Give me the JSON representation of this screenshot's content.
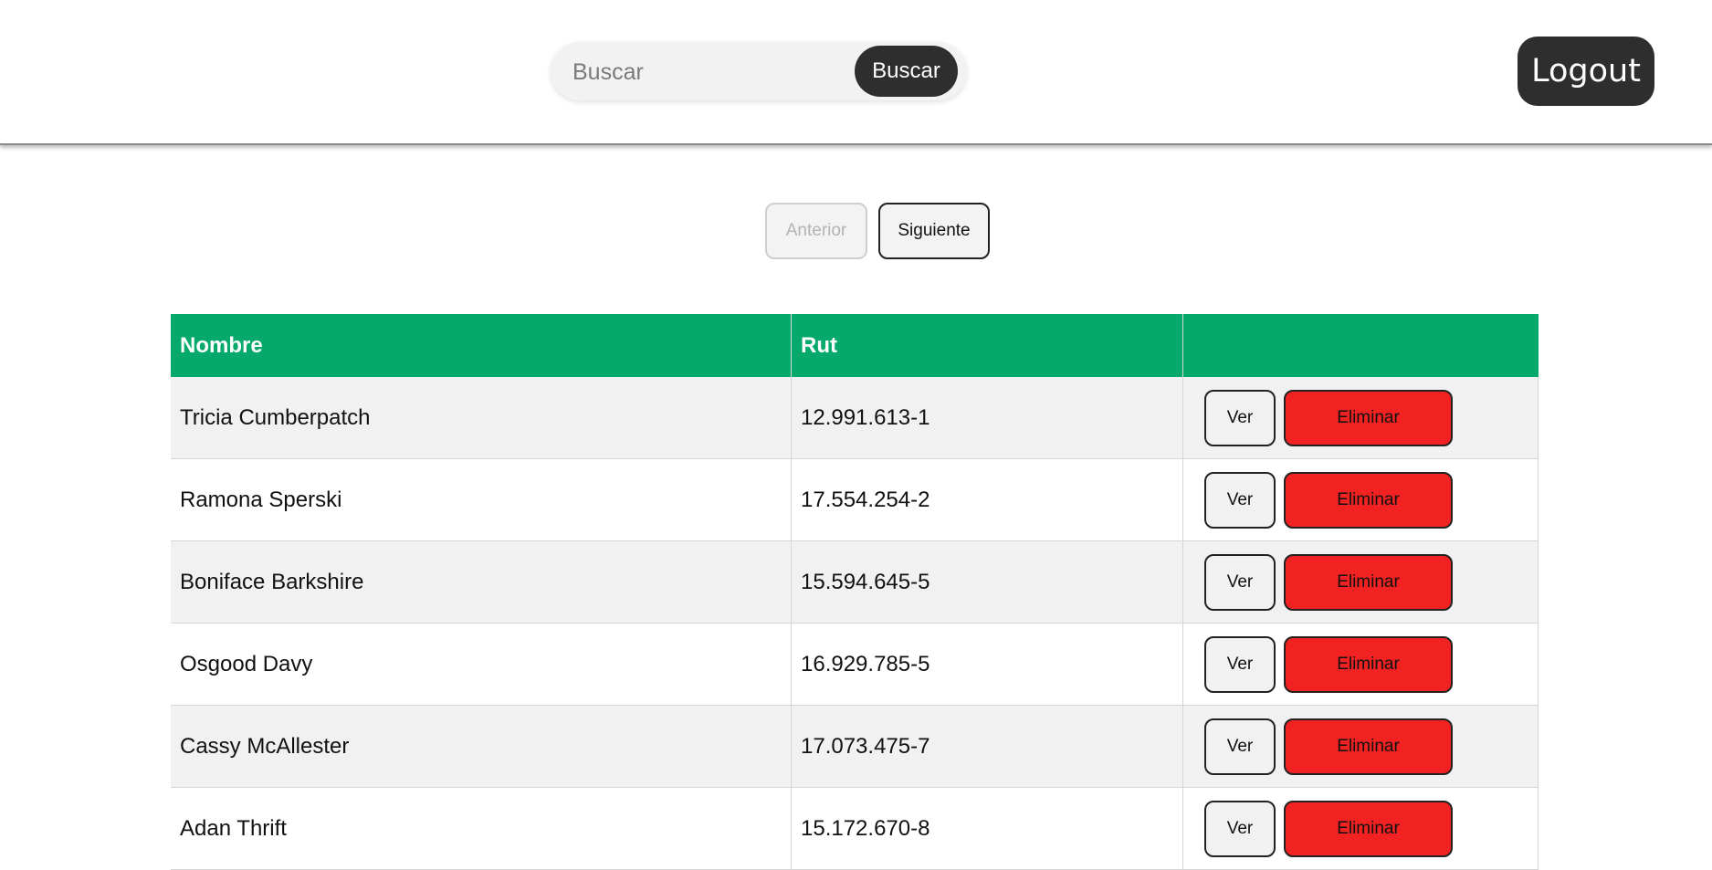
{
  "header": {
    "search": {
      "placeholder": "Buscar",
      "value": "",
      "button_label": "Buscar"
    },
    "logout_label": "Logout"
  },
  "pagination": {
    "prev_label": "Anterior",
    "next_label": "Siguiente",
    "prev_disabled": true
  },
  "table": {
    "columns": [
      "Nombre",
      "Rut",
      ""
    ],
    "rows": [
      {
        "nombre": "Tricia Cumberpatch",
        "rut": "12.991.613-1"
      },
      {
        "nombre": "Ramona Sperski",
        "rut": "17.554.254-2"
      },
      {
        "nombre": "Boniface Barkshire",
        "rut": "15.594.645-5"
      },
      {
        "nombre": "Osgood Davy",
        "rut": "16.929.785-5"
      },
      {
        "nombre": "Cassy McAllester",
        "rut": "17.073.475-7"
      },
      {
        "nombre": "Adan Thrift",
        "rut": "15.172.670-8"
      }
    ],
    "action_labels": {
      "view": "Ver",
      "delete": "Eliminar"
    }
  },
  "colors": {
    "header_green": "#04a96b",
    "delete_red": "#f22222",
    "dark_button": "#2e2e2e"
  }
}
